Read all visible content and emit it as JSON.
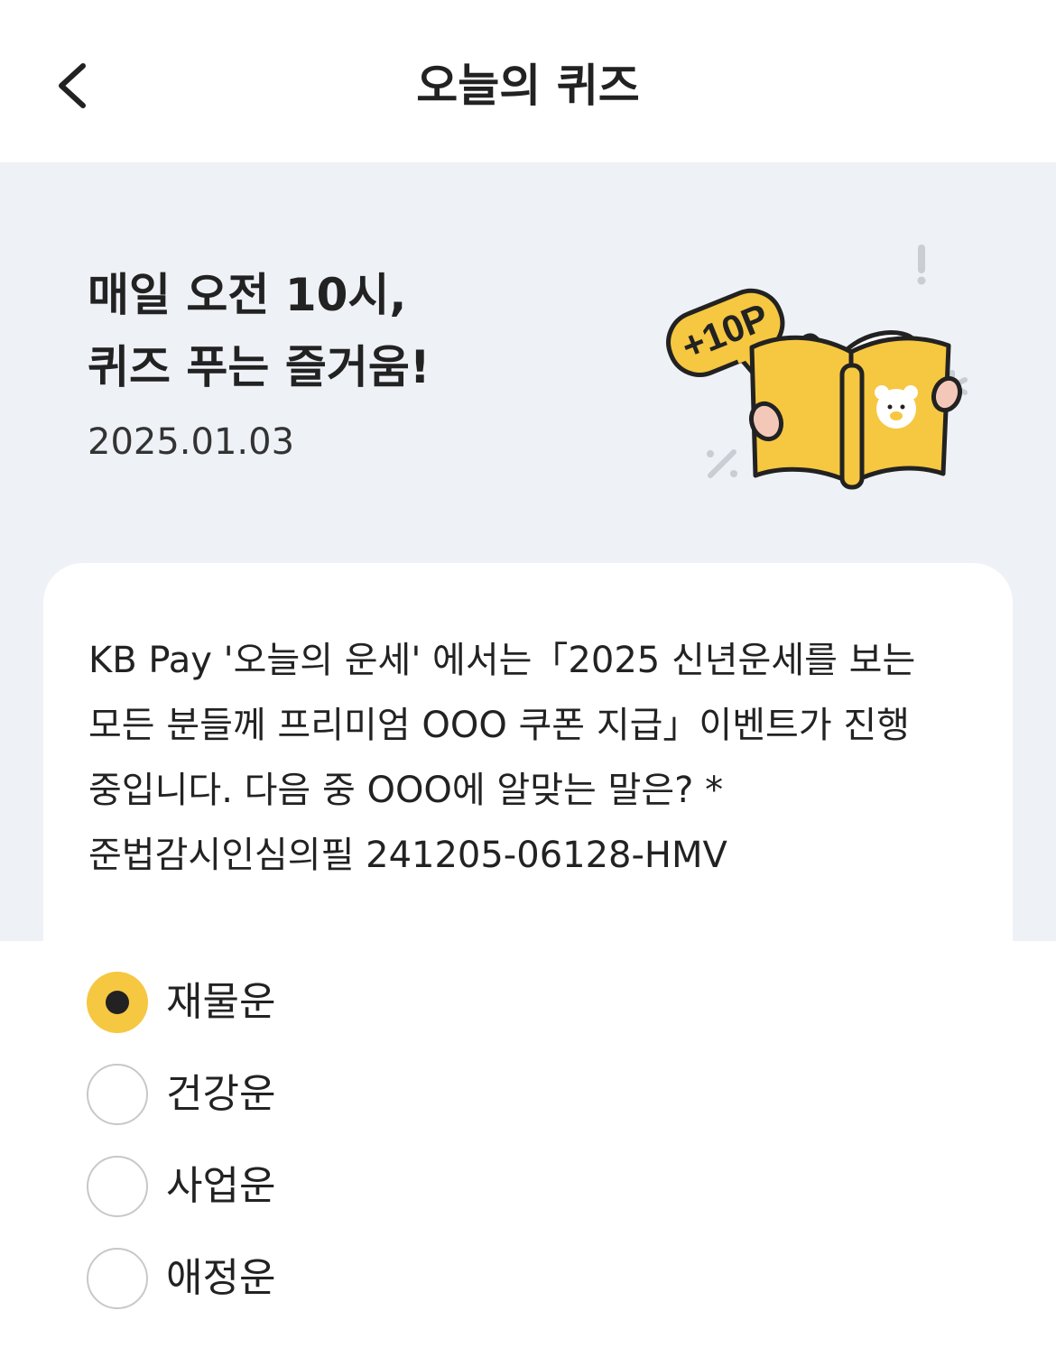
{
  "header": {
    "title": "오늘의 퀴즈",
    "back_icon": "chevron-left-icon"
  },
  "hero": {
    "headline_line1": "매일 오전 10시,",
    "headline_line2": "퀴즈 푸는 즐거움!",
    "date": "2025.01.03",
    "badge_text": "+10P"
  },
  "question": {
    "text": "KB Pay '오늘의 운세' 에서는「2025 신년운세를 보는 모든 분들께 프리미엄 OOO 쿠폰 지급」이벤트가 진행 중입니다. 다음 중 OOO에 알맞는 말은? *준법감시인심의필 241205-06128-HMV"
  },
  "options": [
    {
      "label": "재물운",
      "selected": true
    },
    {
      "label": "건강운",
      "selected": false
    },
    {
      "label": "사업운",
      "selected": false
    },
    {
      "label": "애정운",
      "selected": false
    }
  ],
  "colors": {
    "accent": "#F6C740",
    "hero_bg": "#EEF1F6",
    "text": "#222222",
    "radio_border": "#C8C8C8"
  }
}
